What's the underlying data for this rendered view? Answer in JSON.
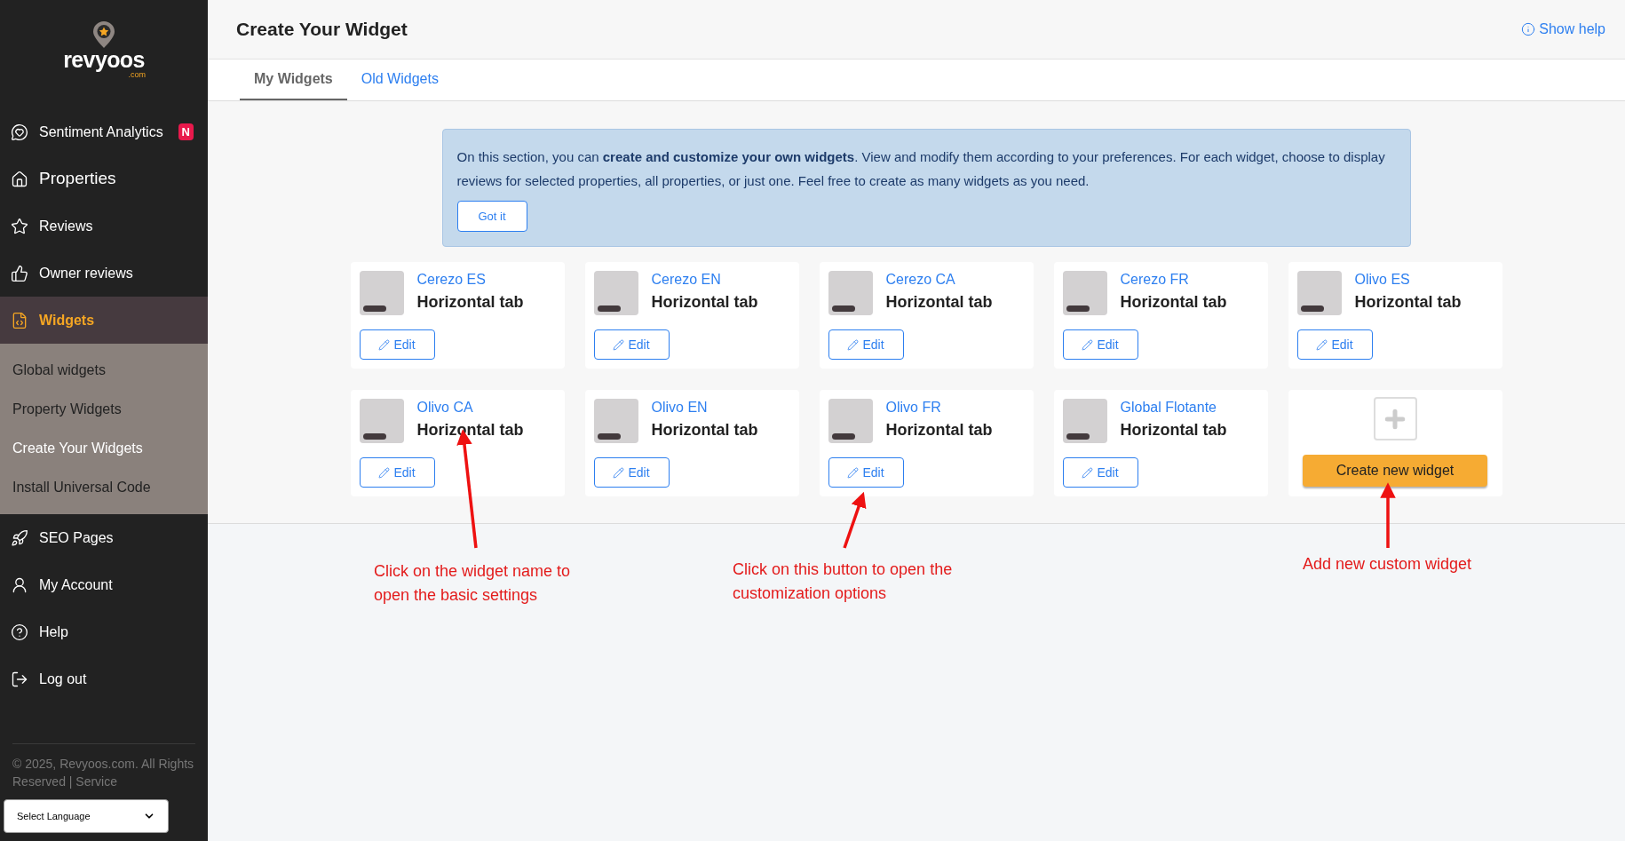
{
  "logo": {
    "name": "revyoos",
    "suffix": ".com"
  },
  "sidebar": {
    "items": [
      {
        "label": "Sentiment Analytics",
        "selected": false,
        "badge": "N"
      },
      {
        "label": "Properties",
        "selected": false
      },
      {
        "label": "Reviews",
        "selected": false
      },
      {
        "label": "Owner reviews",
        "selected": false
      },
      {
        "label": "Widgets",
        "selected": true,
        "expanded": true,
        "children": [
          {
            "label": "Global widgets",
            "selected": false
          },
          {
            "label": "Property Widgets",
            "selected": false
          },
          {
            "label": "Create Your Widgets",
            "selected": true
          },
          {
            "label": "Install Universal Code",
            "selected": false
          }
        ]
      },
      {
        "label": "SEO Pages",
        "selected": false
      },
      {
        "label": "My Account",
        "selected": false
      },
      {
        "label": "Help",
        "selected": false
      },
      {
        "label": "Log out",
        "selected": false
      }
    ],
    "footer": "© 2025, Revyoos.com. All Rights Reserved | Service",
    "language_select": {
      "value": "Select Language"
    }
  },
  "header": {
    "title": "Create Your Widget",
    "help_link": "Show help"
  },
  "tabs": [
    {
      "label": "My Widgets",
      "selected": true
    },
    {
      "label": "Old Widgets",
      "selected": false
    }
  ],
  "info_box": {
    "text": "On this section, you can **create and customize your own widgets**. View and modify them according to your preferences. For each widget, choose to display reviews for selected properties, all properties, or just one. Feel free to create as many widgets as you need.",
    "button": "Got it"
  },
  "widgets": [
    {
      "name": "Cerezo ES",
      "type": "Horizontal tab",
      "button": "Edit"
    },
    {
      "name": "Cerezo EN",
      "type": "Horizontal tab",
      "button": "Edit"
    },
    {
      "name": "Cerezo CA",
      "type": "Horizontal tab",
      "button": "Edit"
    },
    {
      "name": "Cerezo FR",
      "type": "Horizontal tab",
      "button": "Edit"
    },
    {
      "name": "Olivo ES",
      "type": "Horizontal tab",
      "button": "Edit"
    },
    {
      "name": "Olivo CA",
      "type": "Horizontal tab",
      "button": "Edit"
    },
    {
      "name": "Olivo EN",
      "type": "Horizontal tab",
      "button": "Edit"
    },
    {
      "name": "Olivo FR",
      "type": "Horizontal tab",
      "button": "Edit"
    },
    {
      "name": "Global Flotante",
      "type": "Horizontal tab",
      "button": "Edit"
    }
  ],
  "create_card": {
    "button": "Create new widget"
  },
  "annotations": [
    {
      "text": "Click on the widget name to open the basic settings"
    },
    {
      "text": "Click on this button to open the customization options"
    },
    {
      "text": "Add new custom widget"
    }
  ]
}
